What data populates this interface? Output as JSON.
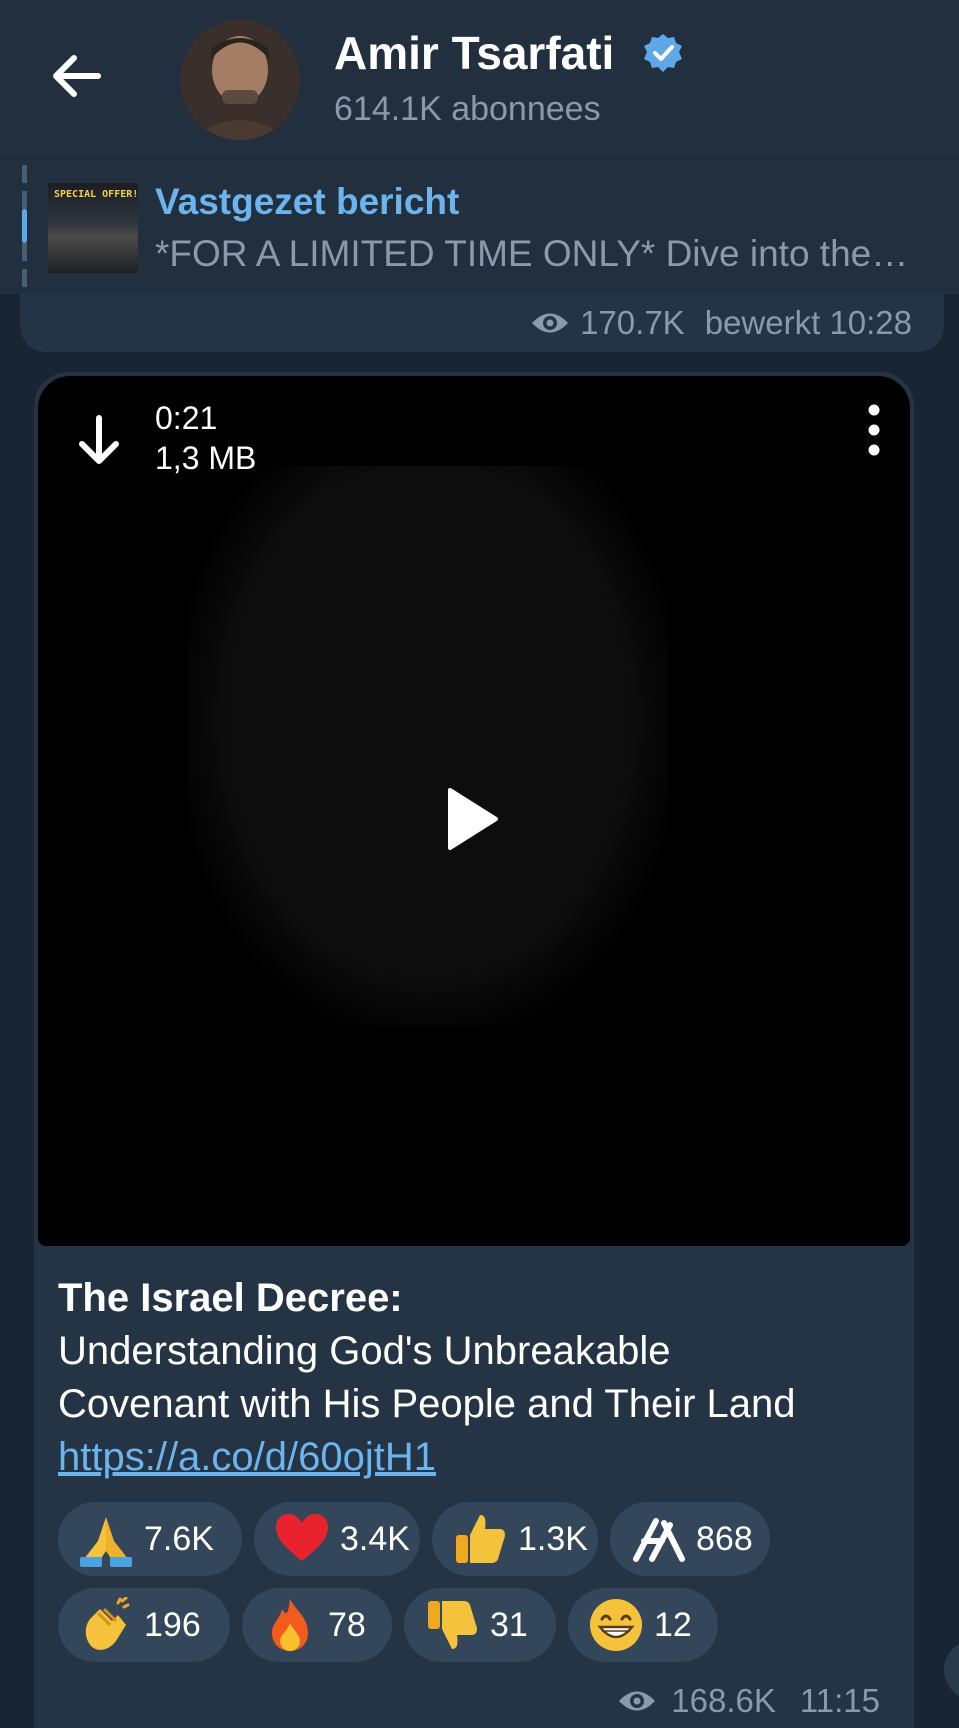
{
  "header": {
    "channel_name": "Amir Tsarfati",
    "subscribers": "614.1K abonnees"
  },
  "pinned": {
    "title": "Vastgezet bericht",
    "text": "*FOR A LIMITED TIME ONLY*   Dive into the…",
    "thumb_label": "SPECIAL OFFER!"
  },
  "previous_message": {
    "views": "170.7K",
    "time": "bewerkt 10:28"
  },
  "message": {
    "video": {
      "duration": "0:21",
      "size": "1,3 MB"
    },
    "caption": {
      "title": "The Israel Decree:",
      "line1": "Understanding God's Unbreakable",
      "line2": "Covenant with His People and Their Land",
      "link": "https://a.co/d/60ojtH1"
    },
    "reactions": [
      {
        "icon": "folded-hands-icon",
        "count": "7.6K"
      },
      {
        "icon": "red-heart-icon",
        "count": "3.4K"
      },
      {
        "icon": "thumbs-up-icon",
        "count": "1.3K"
      },
      {
        "icon": "custom-logo-icon",
        "count": "868"
      },
      {
        "icon": "clapping-hands-icon",
        "count": "196"
      },
      {
        "icon": "fire-icon",
        "count": "78"
      },
      {
        "icon": "thumbs-down-icon",
        "count": "31"
      },
      {
        "icon": "grinning-face-icon",
        "count": "12"
      }
    ],
    "views": "168.6K",
    "time": "11:15"
  },
  "colors": {
    "accent": "#6cb4ee",
    "header_bg": "#222f3e",
    "bubble_bg": "#253445",
    "muted_text": "#8b9aab"
  }
}
